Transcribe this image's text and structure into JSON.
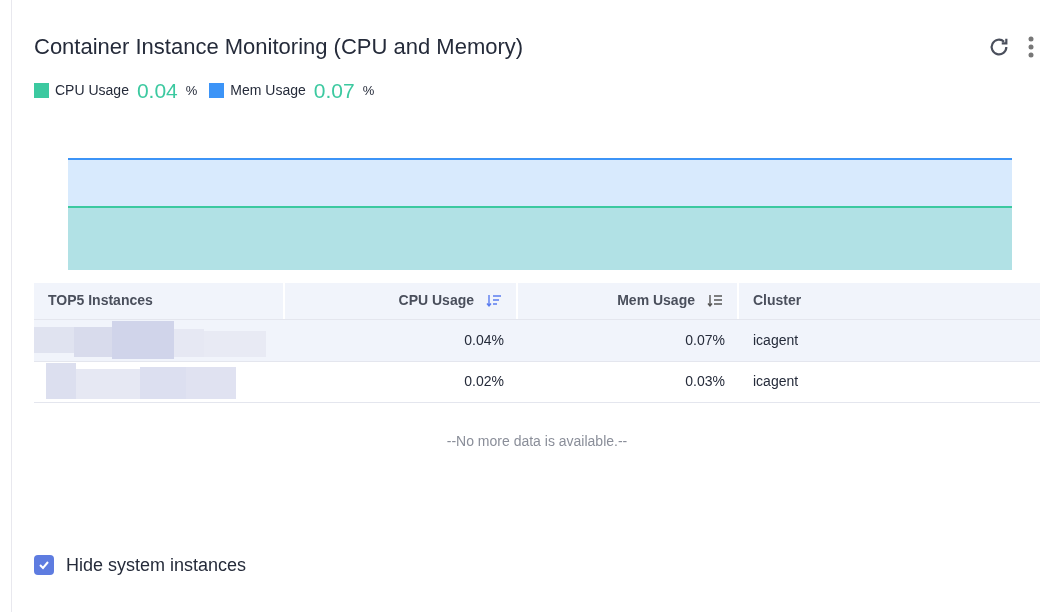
{
  "title": "Container Instance Monitoring (CPU and Memory)",
  "legend": [
    {
      "label": "CPU Usage",
      "value": "0.04",
      "unit": "%",
      "color": "#3cc9a0"
    },
    {
      "label": "Mem Usage",
      "value": "0.07",
      "unit": "%",
      "color": "#3c94f7"
    }
  ],
  "table": {
    "columns": [
      {
        "label": "TOP5 Instances"
      },
      {
        "label": "CPU Usage",
        "sorted": true
      },
      {
        "label": "Mem Usage",
        "sorted": false
      },
      {
        "label": "Cluster"
      }
    ],
    "rows": [
      {
        "selected": true,
        "cells": [
          "0.04%",
          "0.07%",
          "icagent"
        ]
      },
      {
        "selected": false,
        "cells": [
          "0.02%",
          "0.03%",
          "icagent"
        ]
      }
    ]
  },
  "empty_note": "--No more data is available.--",
  "hide_system": {
    "label": "Hide system instances",
    "checked": true
  }
}
